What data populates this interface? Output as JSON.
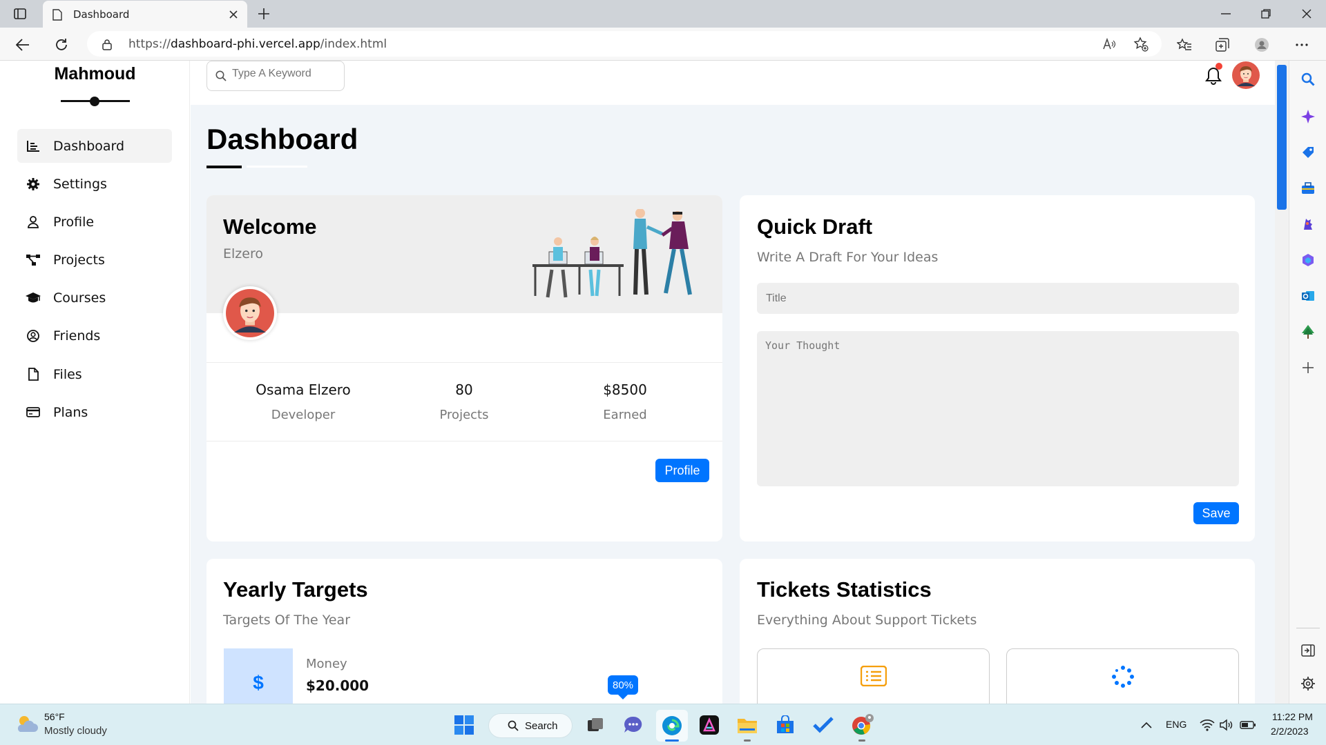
{
  "browser": {
    "tab_title": "Dashboard",
    "url_prefix": "https://",
    "url_domain": "dashboard-phi.vercel.app",
    "url_path": "/index.html"
  },
  "sidebar": {
    "brand": "Mahmoud",
    "items": [
      {
        "label": "Dashboard",
        "icon": "chart-icon",
        "active": true
      },
      {
        "label": "Settings",
        "icon": "gear-icon"
      },
      {
        "label": "Profile",
        "icon": "user-icon"
      },
      {
        "label": "Projects",
        "icon": "diagram-icon"
      },
      {
        "label": "Courses",
        "icon": "graduation-cap-icon"
      },
      {
        "label": "Friends",
        "icon": "user-circle-icon"
      },
      {
        "label": "Files",
        "icon": "file-icon"
      },
      {
        "label": "Plans",
        "icon": "credit-card-icon"
      }
    ]
  },
  "topbar": {
    "search_placeholder": "Type A Keyword"
  },
  "page": {
    "title": "Dashboard"
  },
  "welcome": {
    "title": "Welcome",
    "subtitle": "Elzero",
    "stats": [
      {
        "value": "Osama Elzero",
        "label": "Developer"
      },
      {
        "value": "80",
        "label": "Projects"
      },
      {
        "value": "$8500",
        "label": "Earned"
      }
    ],
    "button": "Profile"
  },
  "quick_draft": {
    "title": "Quick Draft",
    "subtitle": "Write A Draft For Your Ideas",
    "title_placeholder": "Title",
    "thought_placeholder": "Your Thought",
    "button": "Save"
  },
  "yearly_targets": {
    "title": "Yearly Targets",
    "subtitle": "Targets Of The Year",
    "item_label": "Money",
    "item_value": "$20.000",
    "progress_label": "80%",
    "progress": 0.8
  },
  "tickets": {
    "title": "Tickets Statistics",
    "subtitle": "Everything About Support Tickets"
  },
  "taskbar": {
    "weather_temp": "56°F",
    "weather_desc": "Mostly cloudy",
    "search_label": "Search",
    "lang": "ENG",
    "time": "11:22 PM",
    "date": "2/2/2023"
  },
  "colors": {
    "accent": "#0075ff",
    "edge_blue": "#1a73e8",
    "notification": "#f44336"
  }
}
